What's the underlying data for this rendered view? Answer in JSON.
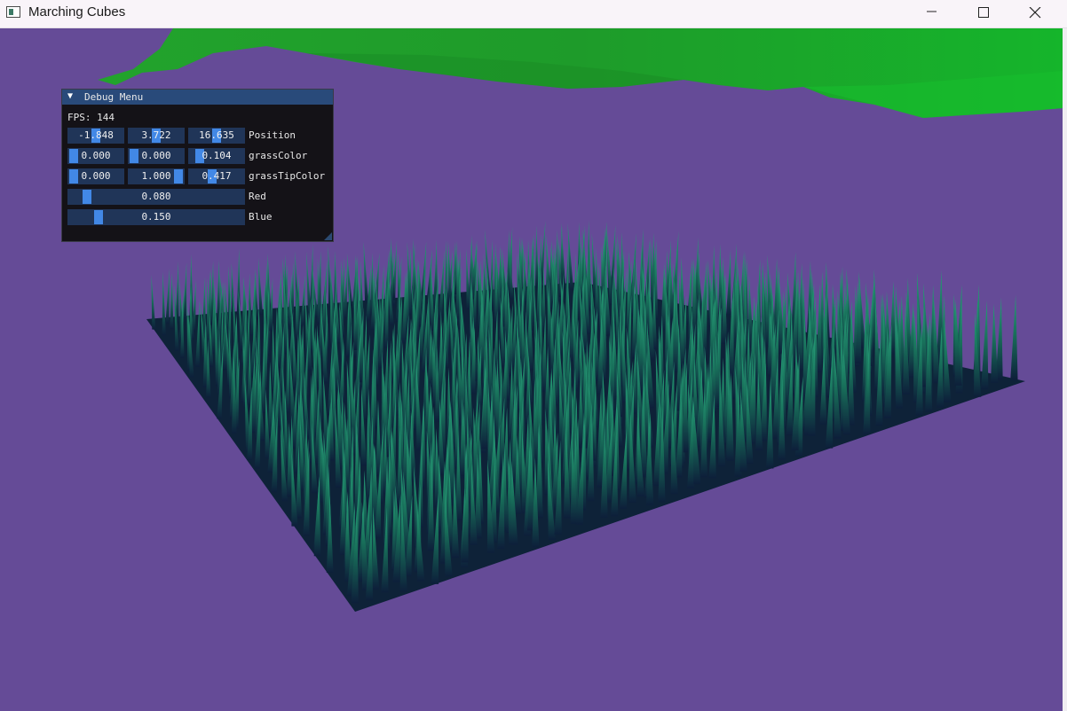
{
  "window": {
    "title": "Marching Cubes",
    "icons": {
      "app": "app-window-icon",
      "minimize": "minimize-icon",
      "maximize": "maximize-icon",
      "close": "close-icon"
    }
  },
  "scene": {
    "background": "#654b97",
    "terrain_color": "#1faa2a",
    "grass_base_color": "#0f2a3a",
    "grass_tip_color": "#1f8f6a"
  },
  "debug_menu": {
    "title": "Debug Menu",
    "collapse_icon": "triangle-down-icon",
    "fps_label": "FPS: 144",
    "rows": [
      {
        "label": "Position",
        "values": [
          "-1.848",
          "3.722",
          "16.635"
        ]
      },
      {
        "label": "grassColor",
        "values": [
          "0.000",
          "0.000",
          "0.104"
        ]
      },
      {
        "label": "grassTipColor",
        "values": [
          "0.000",
          "1.000",
          "0.417"
        ]
      },
      {
        "label": "Red",
        "values": [
          "0.080"
        ]
      },
      {
        "label": "Blue",
        "values": [
          "0.150"
        ]
      }
    ],
    "colors": {
      "header": "#294a7a",
      "frame": "#203558",
      "grab": "#4288e6"
    }
  }
}
